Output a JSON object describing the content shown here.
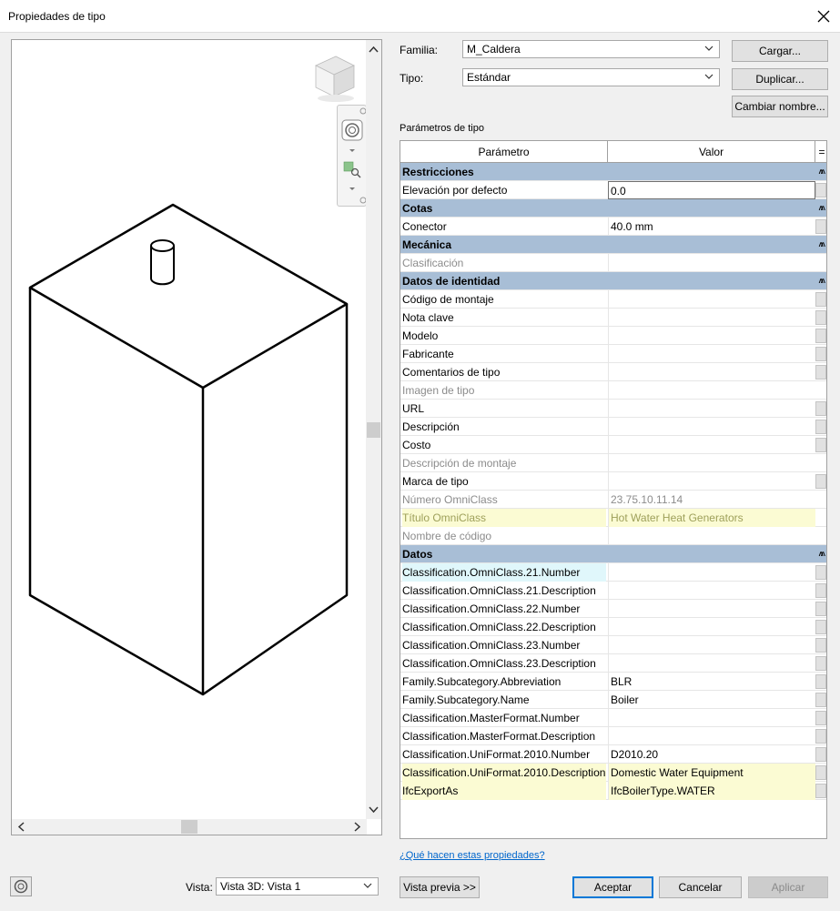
{
  "window": {
    "title": "Propiedades de tipo"
  },
  "family": {
    "label": "Familia:",
    "value": "M_Caldera"
  },
  "type": {
    "label": "Tipo:",
    "value": "Estándar"
  },
  "buttons": {
    "load": "Cargar...",
    "duplicate": "Duplicar...",
    "rename": "Cambiar nombre...",
    "preview": "Vista previa >>",
    "ok": "Aceptar",
    "cancel": "Cancelar",
    "apply": "Aplicar"
  },
  "params": {
    "section_label": "Parámetros de tipo",
    "col_param": "Parámetro",
    "col_value": "Valor",
    "col_sort": "=",
    "groups": [
      {
        "name": "Restricciones",
        "rows": [
          {
            "param": "Elevación por defecto",
            "value": "0.0",
            "state": "edit"
          }
        ]
      },
      {
        "name": "Cotas",
        "rows": [
          {
            "param": "Conector",
            "value": "40.0 mm",
            "state": "button"
          }
        ]
      },
      {
        "name": "Mecánica",
        "rows": [
          {
            "param": "Clasificación",
            "value": "",
            "state": "ro"
          }
        ]
      },
      {
        "name": "Datos de identidad",
        "rows": [
          {
            "param": "Código de montaje",
            "value": "",
            "state": "button"
          },
          {
            "param": "Nota clave",
            "value": "",
            "state": "button"
          },
          {
            "param": "Modelo",
            "value": "",
            "state": "button"
          },
          {
            "param": "Fabricante",
            "value": "",
            "state": "button"
          },
          {
            "param": "Comentarios de tipo",
            "value": "",
            "state": "button"
          },
          {
            "param": "Imagen de tipo",
            "value": "",
            "state": "ro"
          },
          {
            "param": "URL",
            "value": "",
            "state": "button"
          },
          {
            "param": "Descripción",
            "value": "",
            "state": "button"
          },
          {
            "param": "Costo",
            "value": "",
            "state": "button"
          },
          {
            "param": "Descripción de montaje",
            "value": "",
            "state": "ro"
          },
          {
            "param": "Marca de tipo",
            "value": "",
            "state": "button"
          },
          {
            "param": "Número OmniClass",
            "value": "23.75.10.11.14",
            "state": "ro"
          },
          {
            "param": "Título OmniClass",
            "value": "Hot Water Heat Generators",
            "state": "ro-hl"
          },
          {
            "param": "Nombre de código",
            "value": "",
            "state": "ro"
          }
        ]
      },
      {
        "name": "Datos",
        "rows": [
          {
            "param": "Classification.OmniClass.21.Number",
            "value": "",
            "state": "hl-c"
          },
          {
            "param": "Classification.OmniClass.21.Description",
            "value": "",
            "state": "button"
          },
          {
            "param": "Classification.OmniClass.22.Number",
            "value": "",
            "state": "button"
          },
          {
            "param": "Classification.OmniClass.22.Description",
            "value": "",
            "state": "button"
          },
          {
            "param": "Classification.OmniClass.23.Number",
            "value": "",
            "state": "button"
          },
          {
            "param": "Classification.OmniClass.23.Description",
            "value": "",
            "state": "button"
          },
          {
            "param": "Family.Subcategory.Abbreviation",
            "value": "BLR",
            "state": "button"
          },
          {
            "param": "Family.Subcategory.Name",
            "value": "Boiler",
            "state": "button"
          },
          {
            "param": "Classification.MasterFormat.Number",
            "value": "",
            "state": "button"
          },
          {
            "param": "Classification.MasterFormat.Description",
            "value": "",
            "state": "button"
          },
          {
            "param": "Classification.UniFormat.2010.Number",
            "value": "D2010.20",
            "state": "button"
          },
          {
            "param": "Classification.UniFormat.2010.Description",
            "value": "Domestic Water Equipment",
            "state": "hl-y"
          },
          {
            "param": "IfcExportAs",
            "value": "IfcBoilerType.WATER",
            "state": "hl-y"
          }
        ]
      }
    ]
  },
  "help_link": "¿Qué hacen estas propiedades?",
  "view": {
    "label": "Vista:",
    "value": "Vista 3D: Vista 1"
  },
  "colors": {
    "group_header": "#a8bed6",
    "highlight_yellow": "#fbfbd3",
    "highlight_cyan": "#e0f7fb",
    "link": "#0066cc"
  }
}
